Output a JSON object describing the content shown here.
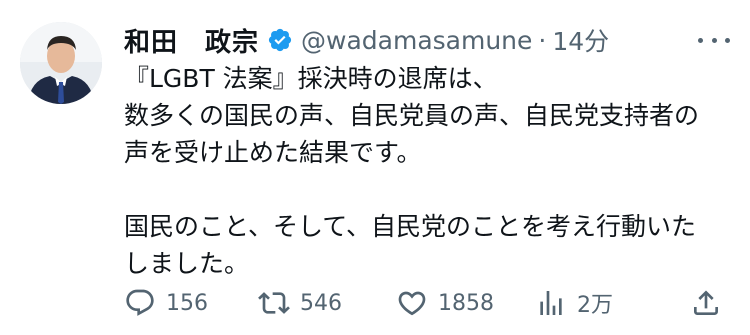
{
  "tweet": {
    "display_name": "和田　政宗",
    "handle": "@wadamasamune",
    "separator": "·",
    "time": "14分",
    "text_lines": [
      "『LGBT 法案』採決時の退席は、",
      "数多くの国民の声、自民党員の声、自民党支持者の",
      "声を受け止めた結果です。",
      "",
      "国民のこと、そして、自民党のことを考え行動いた",
      "しました。"
    ]
  },
  "actions": {
    "replies": "156",
    "retweets": "546",
    "likes": "1858",
    "views": "2万"
  },
  "icons": {
    "verified": "verified-badge-icon",
    "more": "more-options-icon",
    "reply": "reply-icon",
    "retweet": "retweet-icon",
    "like": "heart-icon",
    "views": "views-icon",
    "share": "share-icon"
  },
  "colors": {
    "verified_blue": "#1d9bf0",
    "text": "#0f1419",
    "secondary": "#536471"
  }
}
